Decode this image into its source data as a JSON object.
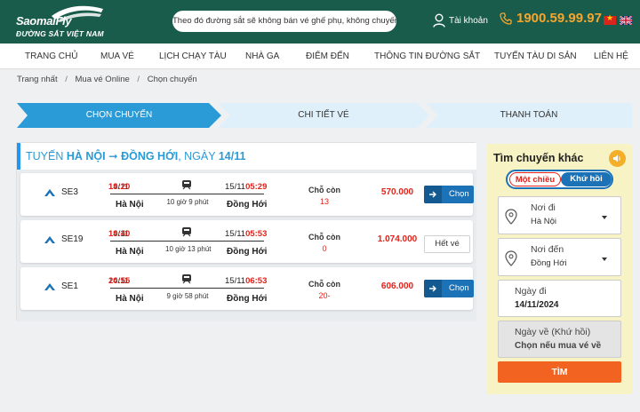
{
  "header": {
    "brand": "SaomaiFly",
    "tagline": "ĐƯỜNG SẮT VIỆT NAM",
    "notice": "Theo đó đường sắt sẽ không bán vé ghế phụ, không chuyến",
    "account_label": "Tài khoản",
    "hotline": "1900.59.99.97",
    "languages": [
      "vi",
      "en"
    ]
  },
  "nav": {
    "items": [
      {
        "label": "TRANG CHỦ"
      },
      {
        "label": "MUA VÉ"
      },
      {
        "label": "LỊCH CHẠY TÀU"
      },
      {
        "label": "NHÀ GA"
      },
      {
        "label": "ĐIỂM ĐẾN"
      },
      {
        "label": "THÔNG TIN ĐƯỜNG SẮT"
      },
      {
        "label": "TUYẾN TÀU DI SẢN"
      },
      {
        "label": "LIÊN HỆ"
      }
    ]
  },
  "breadcrumb": [
    "Trang nhất",
    "Mua vé Online",
    "Chọn chuyến"
  ],
  "steps": [
    {
      "label": "CHỌN CHUYẾN",
      "active": true
    },
    {
      "label": "CHI TIẾT VÉ",
      "active": false
    },
    {
      "label": "THANH TOÁN",
      "active": false
    }
  ],
  "route": {
    "prefix": "TUYẾN",
    "from": "HÀ NỘI",
    "arrow": "➞",
    "to": "ĐỒNG HỚI",
    "date_prefix": ", NGÀY",
    "date": "14/11"
  },
  "trains": [
    {
      "code": "SE3",
      "dep_time": "19:20",
      "dep_date": "14/11",
      "dep_station": "Hà Nội",
      "duration": "10 giờ 9 phút",
      "arr_date": "15/11",
      "arr_time": "05:29",
      "arr_station": "Đồng Hới",
      "seats_label": "Chỗ còn",
      "seats": "13",
      "price": "570.000",
      "action": "Chọn",
      "available": true
    },
    {
      "code": "SE19",
      "dep_time": "19:40",
      "dep_date": "14/11",
      "dep_station": "Hà Nội",
      "duration": "10 giờ 13 phút",
      "arr_date": "15/11",
      "arr_time": "05:53",
      "arr_station": "Đồng Hới",
      "seats_label": "Chỗ còn",
      "seats": "0",
      "price": "1.074.000",
      "action": "Hết vé",
      "available": false
    },
    {
      "code": "SE1",
      "dep_time": "20:55",
      "dep_date": "14/11",
      "dep_station": "Hà Nội",
      "duration": "9 giờ 58 phút",
      "arr_date": "15/11",
      "arr_time": "06:53",
      "arr_station": "Đồng Hới",
      "seats_label": "Chỗ còn",
      "seats": "20-",
      "price": "606.000",
      "action": "Chọn",
      "available": true
    }
  ],
  "search": {
    "title": "Tìm chuyến khác",
    "one_way": "Một chiều",
    "round_trip": "Khứ hồi",
    "origin_label": "Nơi đi",
    "origin_value": "Hà Nội",
    "destination_label": "Nơi đến",
    "destination_value": "Đồng Hới",
    "depart_label": "Ngày đi",
    "depart_value": "14/11/2024",
    "return_label": "Ngày về (Khứ hồi)",
    "return_value": "Chọn nếu mua vé về",
    "submit": "TÌM"
  },
  "colors": {
    "header_bg": "#1a5c4c",
    "accent_blue": "#2196f3",
    "price_red": "#e32119",
    "hotline_orange": "#f6a62d",
    "search_btn": "#f26322",
    "panel_bg": "#f7f3c4"
  }
}
